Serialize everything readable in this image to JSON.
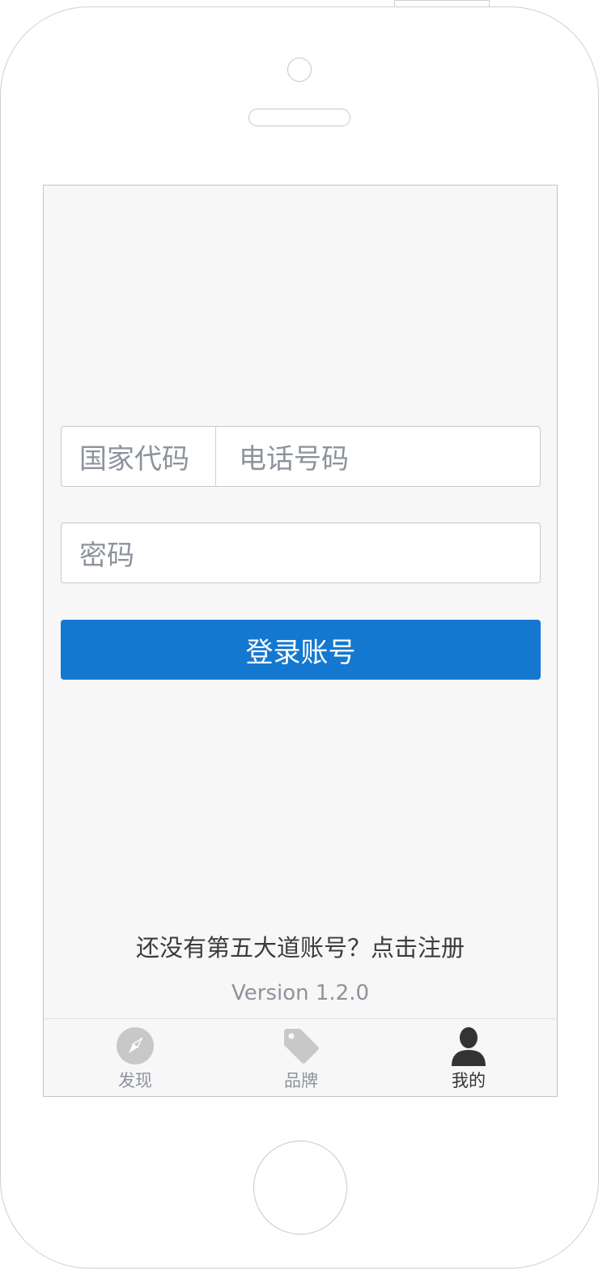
{
  "form": {
    "country_code_placeholder": "国家代码",
    "phone_placeholder": "电话号码",
    "password_placeholder": "密码",
    "login_button": "登录账号"
  },
  "footer": {
    "register_text": "还没有第五大道账号？点击注册",
    "version": "Version 1.2.0"
  },
  "tabbar": {
    "items": [
      {
        "label": "发现",
        "icon": "compass-icon",
        "active": false
      },
      {
        "label": "品牌",
        "icon": "tag-icon",
        "active": false
      },
      {
        "label": "我的",
        "icon": "user-icon",
        "active": true
      }
    ]
  },
  "colors": {
    "primary": "#1478d0",
    "placeholder": "#8d939c",
    "icon_inactive": "#c8c8c8",
    "icon_active": "#333333"
  }
}
